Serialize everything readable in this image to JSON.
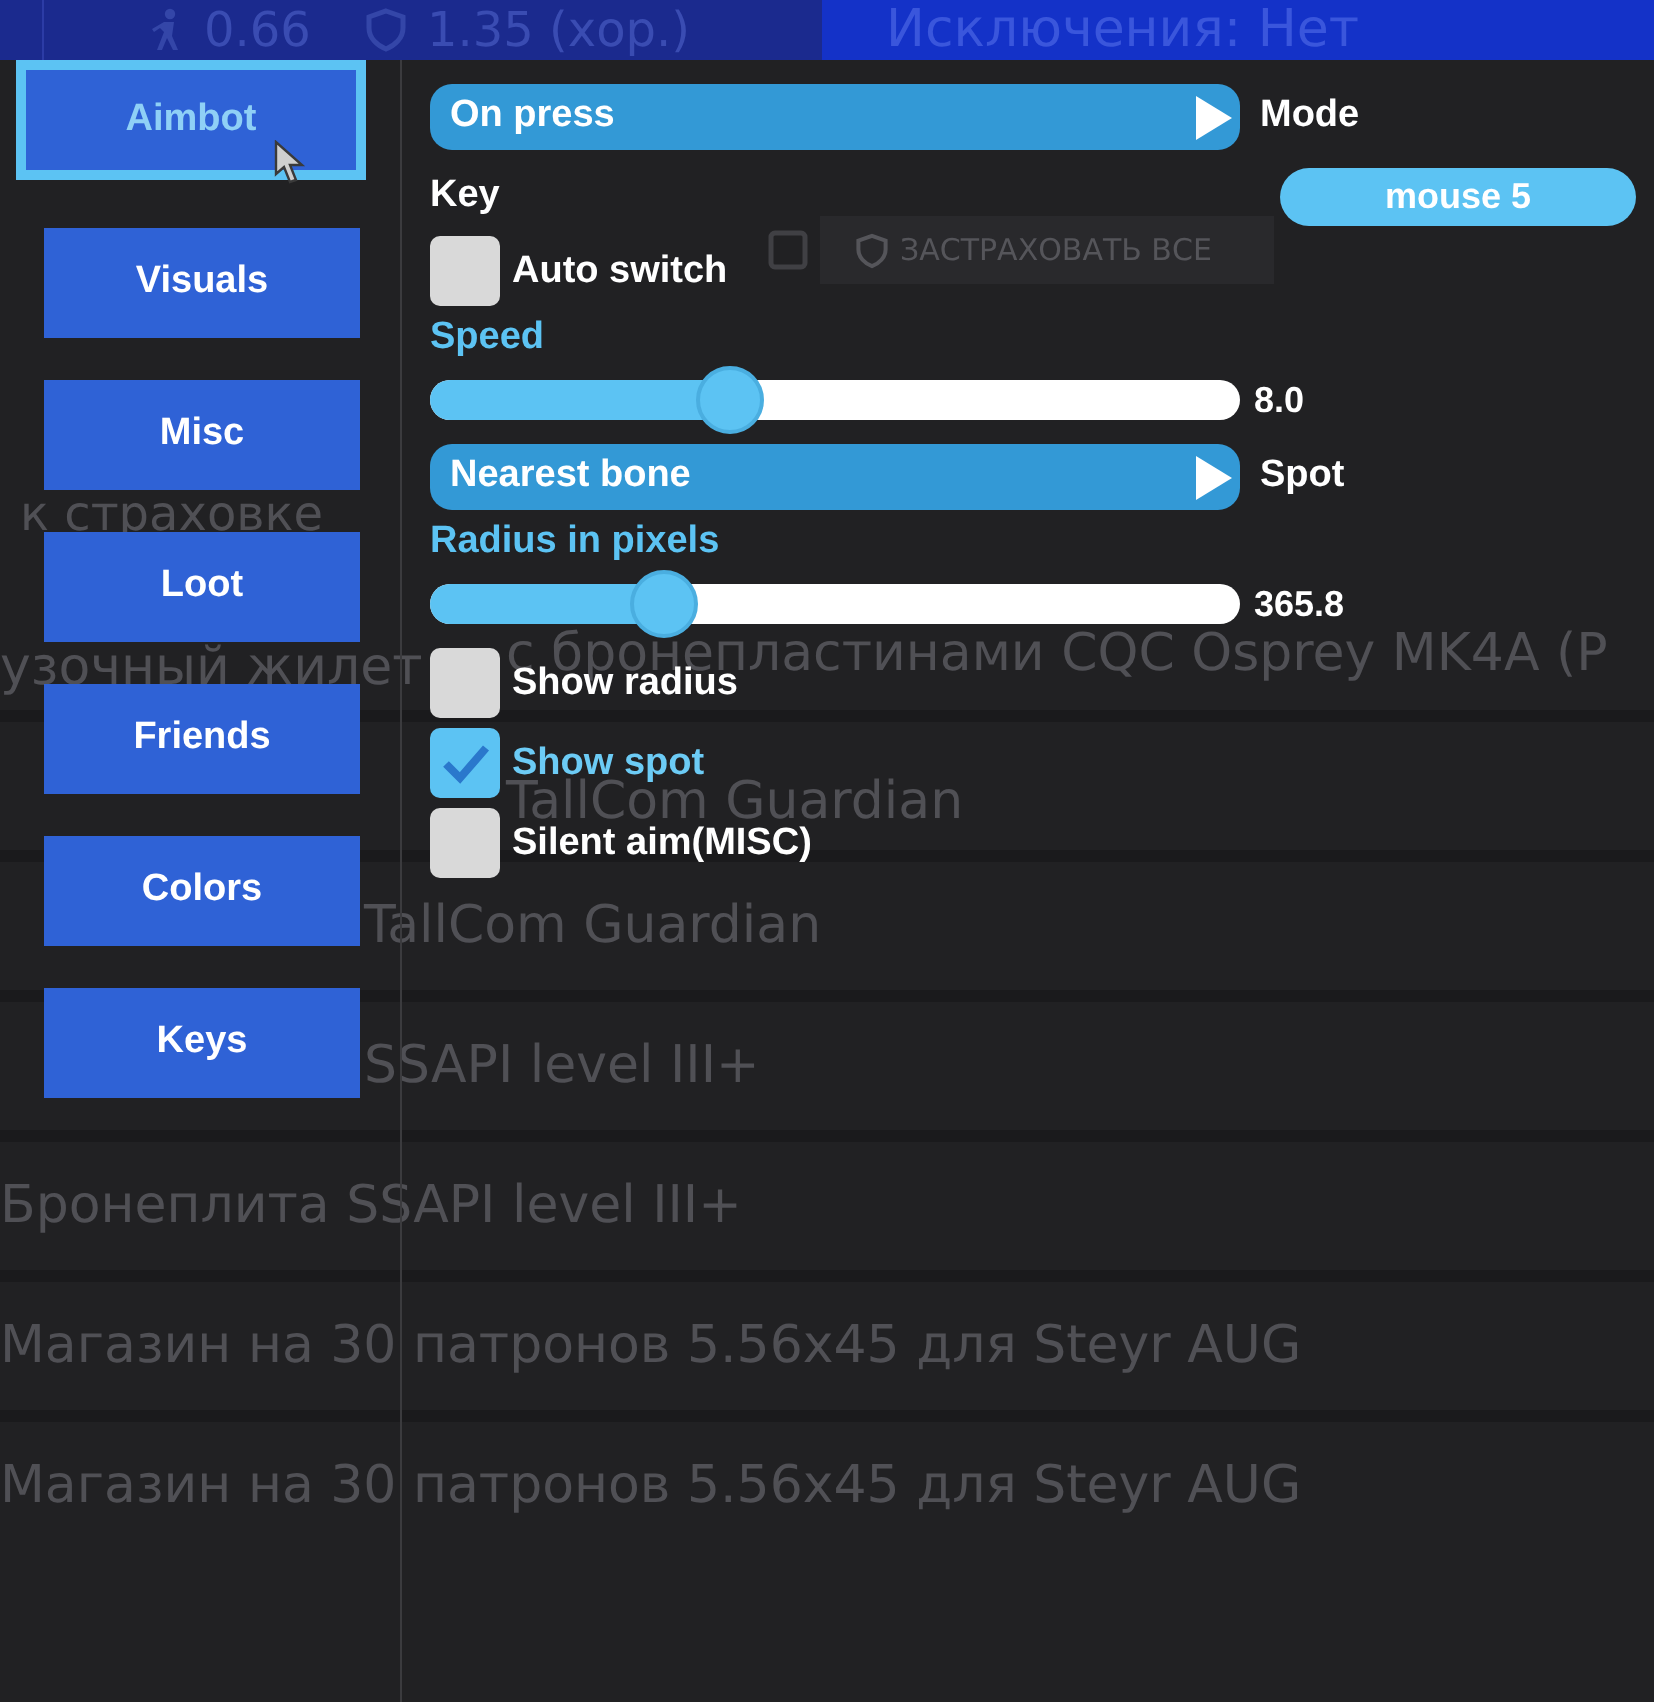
{
  "background": {
    "stats": [
      {
        "kind": "figure",
        "text": "0.66"
      },
      {
        "kind": "shield",
        "text": "1.35 (хор.)"
      }
    ],
    "exclusions": "Исключения: Нет",
    "insure_all_button": "ЗАСТРАХОВАТЬ ВСЕ",
    "section_label": "к страховке",
    "items": [
      {
        "kind": "split",
        "parts": [
          "узочный жилет",
          "с бронепластинами CQC Osprey MK4A (P"
        ]
      },
      {
        "kind": "shifted",
        "text": "TallCom Guardian"
      },
      {
        "kind": "clipped",
        "text": "TallCom Guardian"
      },
      {
        "kind": "clipped",
        "text": "SSAPI level III+"
      },
      {
        "kind": "full",
        "text": "Бронеплита SSAPI level III+"
      },
      {
        "kind": "full",
        "text": "Магазин на 30 патронов 5.56x45 для Steyr AUG"
      },
      {
        "kind": "full",
        "text": "Магазин на 30 патронов 5.56x45 для Steyr AUG"
      }
    ]
  },
  "tabs": [
    {
      "label": "Aimbot",
      "selected": true
    },
    {
      "label": "Visuals",
      "selected": false
    },
    {
      "label": "Misc",
      "selected": false
    },
    {
      "label": "Loot",
      "selected": false
    },
    {
      "label": "Friends",
      "selected": false
    },
    {
      "label": "Colors",
      "selected": false
    },
    {
      "label": "Keys",
      "selected": false
    }
  ],
  "controls": [
    {
      "kind": "dropdown",
      "text": "On press",
      "caption": "Mode"
    },
    {
      "kind": "keybind",
      "label": "Key",
      "value": "mouse 5"
    },
    {
      "kind": "checkbox",
      "label": "Auto switch",
      "checked": false
    },
    {
      "kind": "heading",
      "label": "Speed"
    },
    {
      "kind": "slider",
      "level": 0.37,
      "reading": "8.0"
    },
    {
      "kind": "dropdown",
      "text": "Nearest bone",
      "caption": "Spot"
    },
    {
      "kind": "heading",
      "label": "Radius in pixels"
    },
    {
      "kind": "slider",
      "level": 0.29,
      "reading": "365.8"
    },
    {
      "kind": "checkbox",
      "label": "Show radius",
      "checked": false
    },
    {
      "kind": "checkbox",
      "label": "Show spot",
      "checked": true
    },
    {
      "kind": "checkbox",
      "label": "Silent aim(MISC)",
      "checked": false
    }
  ]
}
